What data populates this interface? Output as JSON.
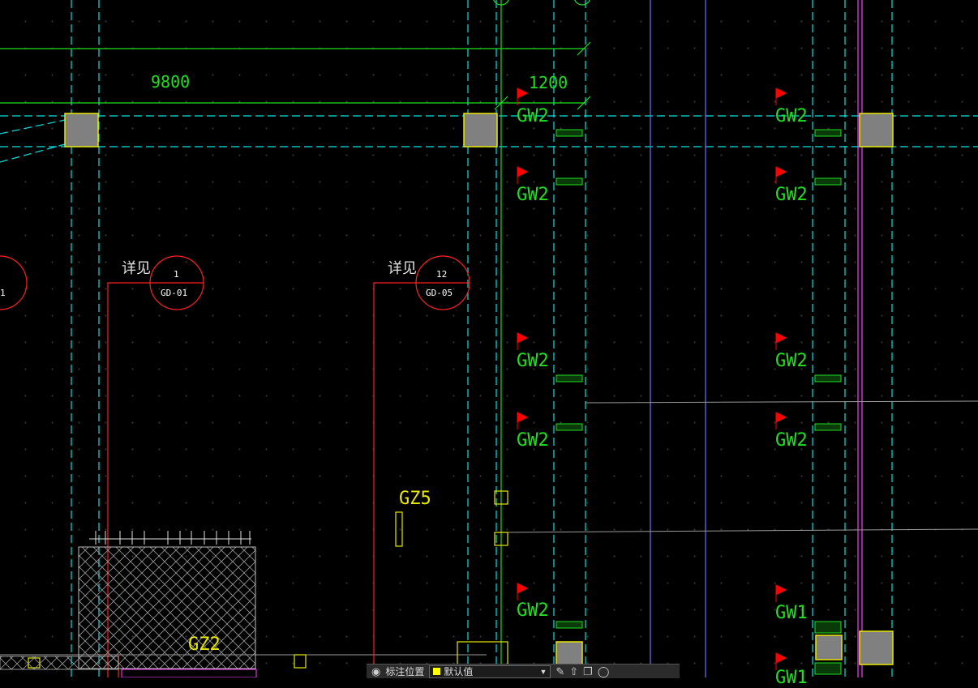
{
  "drawing": {
    "dimensions": [
      {
        "id": "dim-9800",
        "text": "9800"
      },
      {
        "id": "dim-1200",
        "text": "1200"
      }
    ],
    "wall_tags": [
      {
        "id": "tag-1",
        "text": "GW2"
      },
      {
        "id": "tag-2",
        "text": "GW2"
      },
      {
        "id": "tag-3",
        "text": "GW2"
      },
      {
        "id": "tag-4",
        "text": "GW2"
      },
      {
        "id": "tag-5",
        "text": "GW2"
      },
      {
        "id": "tag-6",
        "text": "GW2"
      },
      {
        "id": "tag-7",
        "text": "GW2"
      },
      {
        "id": "tag-8",
        "text": "GW2"
      },
      {
        "id": "tag-9",
        "text": "GW2"
      },
      {
        "id": "tag-10",
        "text": "GW1"
      },
      {
        "id": "tag-11",
        "text": "GW1"
      }
    ],
    "column_tags": [
      {
        "id": "gz5",
        "text": "GZ5"
      },
      {
        "id": "gz2",
        "text": "GZ2"
      }
    ],
    "detail_callouts": [
      {
        "id": "callout-1",
        "note": "详见",
        "number": "1",
        "sheet": "GD-01"
      },
      {
        "id": "callout-2",
        "note": "详见",
        "number": "12",
        "sheet": "GD-05"
      },
      {
        "id": "callout-3",
        "note": "",
        "number": "1",
        "sheet": ""
      }
    ],
    "colors": {
      "background": "#000000",
      "grid_axis": "#00e5e5",
      "dimension": "#20e020",
      "detail_line": "#ff2020",
      "column_fill": "#808080",
      "column_outline": "#e8e800",
      "purple_line": "#7070ff",
      "magenta_line": "#ff40ff",
      "flag": "#ff0000"
    }
  },
  "statusbar": {
    "label": "标注位置",
    "layer_name": "默认值",
    "icons": [
      "binoculars-icon",
      "pencil-icon",
      "export-icon",
      "copy-icon",
      "cylinder-icon"
    ]
  }
}
